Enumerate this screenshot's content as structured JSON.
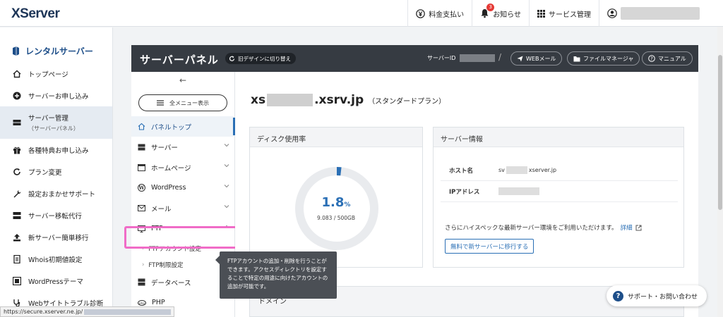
{
  "header": {
    "logo": "XServer",
    "nav": {
      "billing": "料金支払い",
      "notifications": "お知らせ",
      "notification_count": "3",
      "service_mgmt": "サービス管理"
    }
  },
  "sidebar": {
    "heading": "レンタルサーバー",
    "items": [
      {
        "label": "トップページ"
      },
      {
        "label": "サーバーお申し込み"
      },
      {
        "label": "サーバー管理",
        "sub": "（サーバーパネル）"
      },
      {
        "label": "各種特典お申し込み"
      },
      {
        "label": "プラン変更"
      },
      {
        "label": "設定おまかせサポート"
      },
      {
        "label": "サーバー移転代行"
      },
      {
        "label": "新サーバー簡単移行"
      },
      {
        "label": "Whois初期値設定"
      },
      {
        "label": "WordPressテーマ"
      },
      {
        "label": "Webサイトトラブル診断"
      }
    ]
  },
  "panel_header": {
    "title": "サーバーパネル",
    "old_design": "旧デザインに切り替え",
    "server_id_label": "サーバーID",
    "webmail": "WEBメール",
    "file_manager": "ファイルマネージャ",
    "manual": "マニュアル"
  },
  "submenu": {
    "all_menu": "全メニュー表示",
    "items": {
      "panel_top": "パネルトップ",
      "server": "サーバー",
      "homepage": "ホームページ",
      "wordpress": "WordPress",
      "mail": "メール",
      "ftp": "FTP",
      "ftp_account": "FTPアカウント設定",
      "ftp_restrict": "FTP制限設定",
      "database": "データベース",
      "php": "PHP"
    }
  },
  "tooltip": {
    "text": "FTPアカウントの追加・削除を行うことができます。アクセスディレクトリを設定することで特定の用途に向けたアカウントの追加が可能です。"
  },
  "main": {
    "domain_prefix": "xs",
    "domain_suffix": ".xsrv.jp",
    "plan": "（スタンダードプラン）",
    "disk_card": {
      "title": "ディスク使用率",
      "percent": "1.8",
      "percent_unit": "%",
      "usage_fraction": 0.018,
      "usage_text": "9.083 / 500GB"
    },
    "server_info": {
      "title": "サーバー情報",
      "host_label": "ホスト名",
      "host_prefix": "sv",
      "host_suffix": "xserver.jp",
      "ip_label": "IPアドレス",
      "upsell": "さらにハイスペックな最新サーバー環境をご利用いただけます。",
      "detail_link": "詳細",
      "migrate_button": "無料で新サーバーに移行する"
    },
    "domain_card_title": "ドメイン"
  },
  "support_button": "サポート・お問い合わせ",
  "status_url": "https://secure.xserver.ne.jp/",
  "colors": {
    "accent": "#2a6fb5",
    "header_dark": "#363b42",
    "highlight": "#f06cc7"
  }
}
